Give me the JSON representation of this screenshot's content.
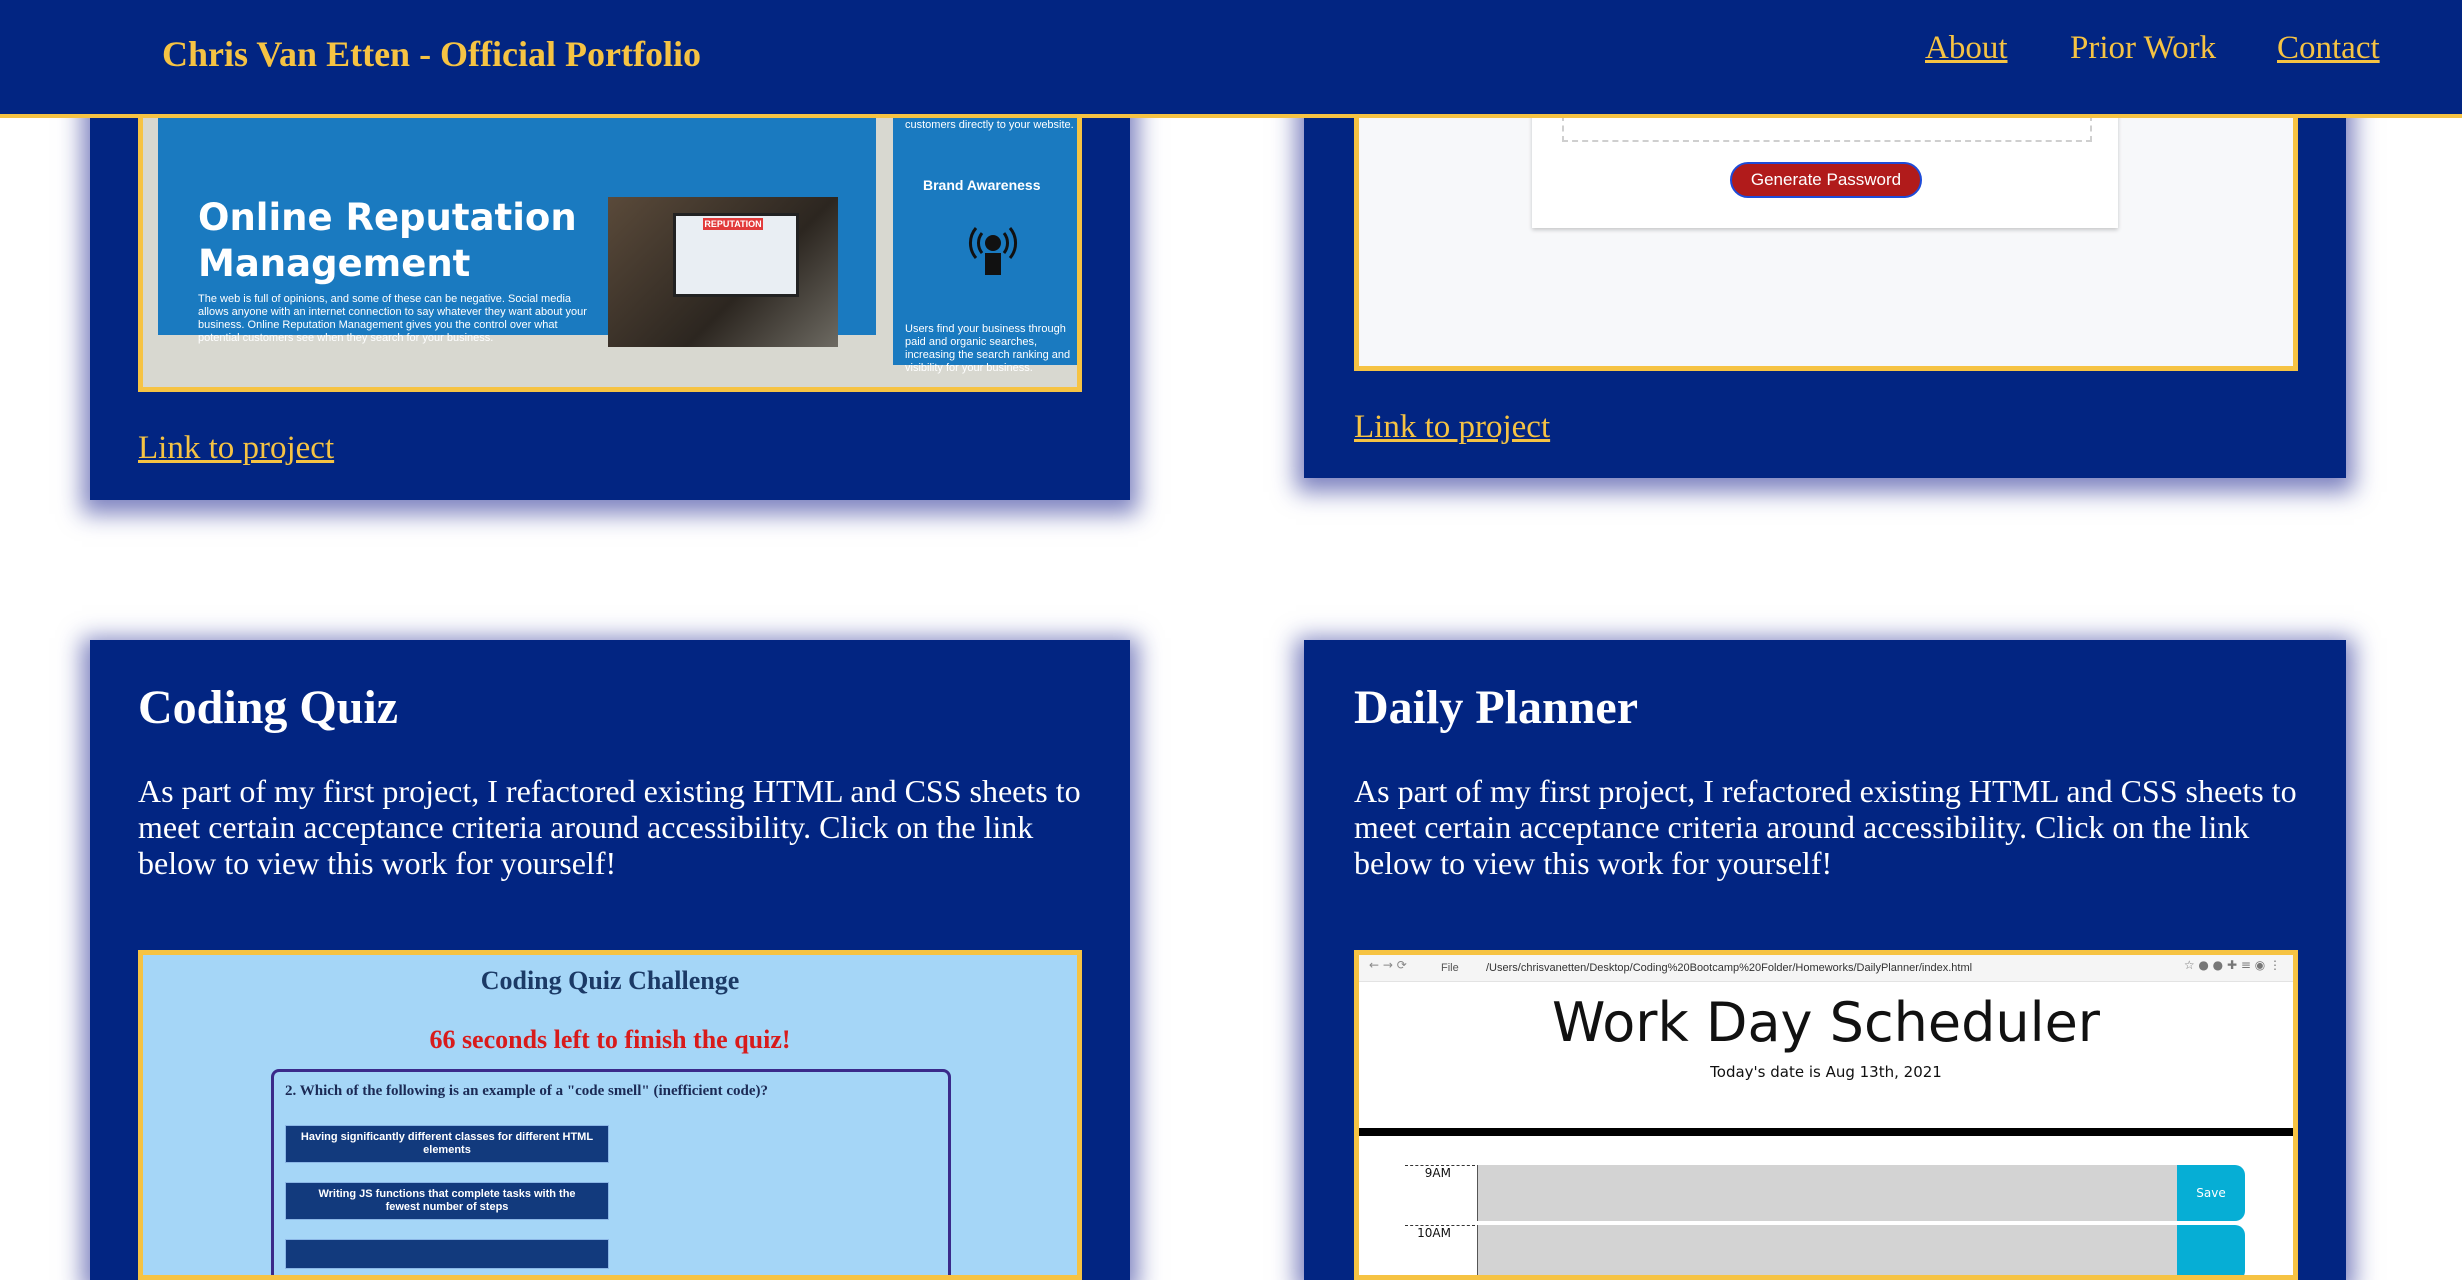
{
  "header": {
    "brand": "Chris Van Etten - Official Portfolio",
    "nav": [
      {
        "label": "About"
      },
      {
        "label": "Prior Work"
      },
      {
        "label": "Contact"
      }
    ]
  },
  "cards": [
    {
      "id": "reputation",
      "link_label": "Link to project",
      "screenshot": {
        "title": "Online Reputation Management",
        "body": "The web is full of opinions, and some of these can be negative. Social media allows anyone with an internet connection to say whatever they want about your business. Online Reputation Management gives you the control over what potential customers see when they search for your business.",
        "side_top_text": "customers directly to your website.",
        "side_heading": "Brand Awareness",
        "side_bottom_text": "Users find your business through paid and organic searches, increasing the search ranking and visibility for your business.",
        "photo_badge": "REPUTATION"
      }
    },
    {
      "id": "password",
      "link_label": "Link to project",
      "screenshot": {
        "button_label": "Generate Password"
      }
    },
    {
      "id": "coding-quiz",
      "title": "Coding Quiz",
      "description": "As part of my first project, I refactored existing HTML and CSS sheets to meet certain acceptance criteria around accessibility. Click on the link below to view this work for yourself!",
      "screenshot": {
        "heading": "Coding Quiz Challenge",
        "timer": "66 seconds left to finish the quiz!",
        "question": "2. Which of the following is an example of a \"code smell\" (inefficient code)?",
        "options": [
          "Having significantly different classes for different HTML elements",
          "Writing JS functions that complete tasks with the fewest number of steps",
          ""
        ]
      }
    },
    {
      "id": "daily-planner",
      "title": "Daily Planner",
      "description": "As part of my first project, I refactored existing HTML and CSS sheets to meet certain acceptance criteria around accessibility. Click on the link below to view this work for yourself!",
      "screenshot": {
        "browser_file_label": "File",
        "browser_url": "/Users/chrisvanetten/Desktop/Coding%20Bootcamp%20Folder/Homeworks/DailyPlanner/index.html",
        "heading": "Work Day Scheduler",
        "date": "Today's date is Aug 13th, 2021",
        "hours": [
          {
            "label": "9AM",
            "save": "Save"
          },
          {
            "label": "10AM",
            "save": ""
          }
        ]
      }
    }
  ],
  "colors": {
    "navy": "#022582",
    "gold": "#f6c343",
    "white": "#ffffff"
  }
}
